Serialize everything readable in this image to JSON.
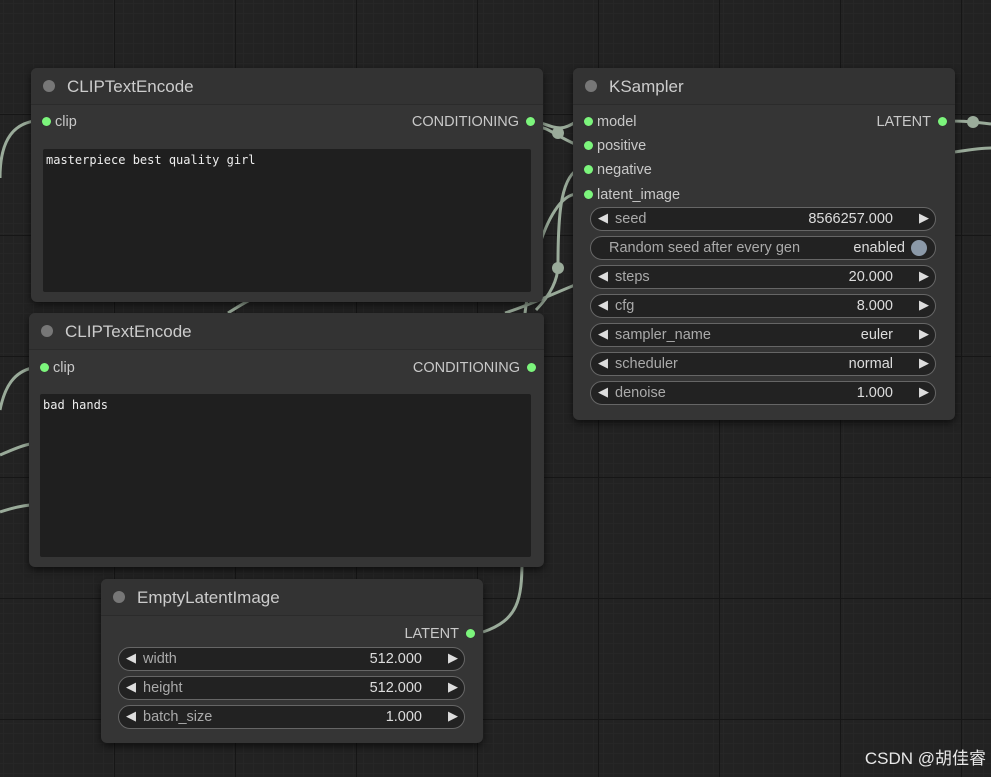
{
  "nodes": {
    "positive": {
      "title": "CLIPTextEncode",
      "input": "clip",
      "output": "CONDITIONING",
      "text": "masterpiece best quality girl"
    },
    "negative": {
      "title": "CLIPTextEncode",
      "input": "clip",
      "output": "CONDITIONING",
      "text": "bad hands"
    },
    "ksampler": {
      "title": "KSampler",
      "inputs": [
        "model",
        "positive",
        "negative",
        "latent_image"
      ],
      "output": "LATENT",
      "widgets": {
        "seed": {
          "label": "seed",
          "value": "8566257.000"
        },
        "random": {
          "label": "Random seed after every gen",
          "value": "enabled"
        },
        "steps": {
          "label": "steps",
          "value": "20.000"
        },
        "cfg": {
          "label": "cfg",
          "value": "8.000"
        },
        "sampler_name": {
          "label": "sampler_name",
          "value": "euler"
        },
        "scheduler": {
          "label": "scheduler",
          "value": "normal"
        },
        "denoise": {
          "label": "denoise",
          "value": "1.000"
        }
      }
    },
    "empty_latent": {
      "title": "EmptyLatentImage",
      "output": "LATENT",
      "widgets": {
        "width": {
          "label": "width",
          "value": "512.000"
        },
        "height": {
          "label": "height",
          "value": "512.000"
        },
        "batch_size": {
          "label": "batch_size",
          "value": "1.000"
        }
      }
    }
  },
  "watermark": "CSDN @胡佳睿",
  "colors": {
    "slot": "#7CF57C",
    "link": "#9aab9a",
    "node_bg": "#353535",
    "canvas_bg": "#222222"
  }
}
